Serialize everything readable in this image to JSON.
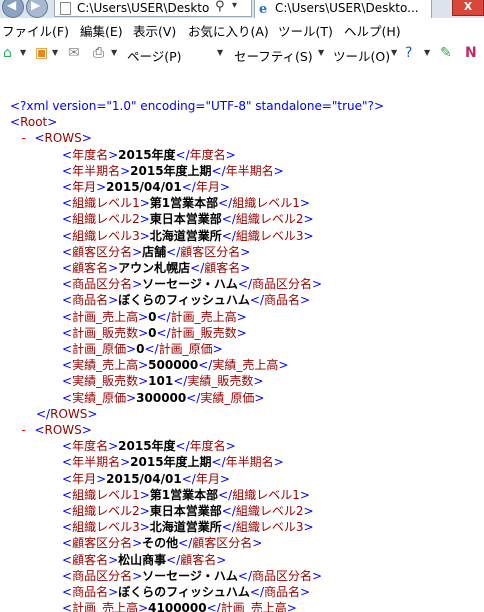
{
  "tabs": {
    "address": "C:\\Users\\USER\\Deskto",
    "active_tab": "C:\\Users\\USER\\Deskto...",
    "close_label": "X"
  },
  "menu": [
    "ファイル(F)",
    "編集(E)",
    "表示(V)",
    "お気に入り(A)",
    "ツール(T)",
    "ヘルプ(H)"
  ],
  "command_bar": {
    "page_label": "ページ(P)",
    "safety_label": "セーフティ(S)",
    "tools_label": "ツール(O)"
  },
  "xml": {
    "declaration": "<?xml version=\"1.0\" encoding=\"UTF-8\" standalone=\"true\"?>",
    "root_tag": "Root",
    "rows_tag": "ROWS",
    "rows": [
      {
        "fields": [
          {
            "name": "年度名",
            "value": "2015年度"
          },
          {
            "name": "年半期名",
            "value": "2015年度上期"
          },
          {
            "name": "年月",
            "value": "2015/04/01"
          },
          {
            "name": "組織レベル1",
            "value": "第1営業本部"
          },
          {
            "name": "組織レベル2",
            "value": "東日本営業部"
          },
          {
            "name": "組織レベル3",
            "value": "北海道営業所"
          },
          {
            "name": "顧客区分名",
            "value": "店舗"
          },
          {
            "name": "顧客名",
            "value": "アウン札幌店"
          },
          {
            "name": "商品区分名",
            "value": "ソーセージ・ハム"
          },
          {
            "name": "商品名",
            "value": "ぼくらのフィッシュハム"
          },
          {
            "name": "計画_売上高",
            "value": "0"
          },
          {
            "name": "計画_販売数",
            "value": "0"
          },
          {
            "name": "計画_原価",
            "value": "0"
          },
          {
            "name": "実績_売上高",
            "value": "500000"
          },
          {
            "name": "実績_販売数",
            "value": "101"
          },
          {
            "name": "実績_原価",
            "value": "300000"
          }
        ]
      },
      {
        "fields": [
          {
            "name": "年度名",
            "value": "2015年度"
          },
          {
            "name": "年半期名",
            "value": "2015年度上期"
          },
          {
            "name": "年月",
            "value": "2015/04/01"
          },
          {
            "name": "組織レベル1",
            "value": "第1営業本部"
          },
          {
            "name": "組織レベル2",
            "value": "東日本営業部"
          },
          {
            "name": "組織レベル3",
            "value": "北海道営業所"
          },
          {
            "name": "顧客区分名",
            "value": "その他"
          },
          {
            "name": "顧客名",
            "value": "松山商事"
          },
          {
            "name": "商品区分名",
            "value": "ソーセージ・ハム"
          },
          {
            "name": "商品名",
            "value": "ぼくらのフィッシュハム"
          },
          {
            "name": "計画_売上高",
            "value": "4100000"
          }
        ]
      }
    ]
  }
}
